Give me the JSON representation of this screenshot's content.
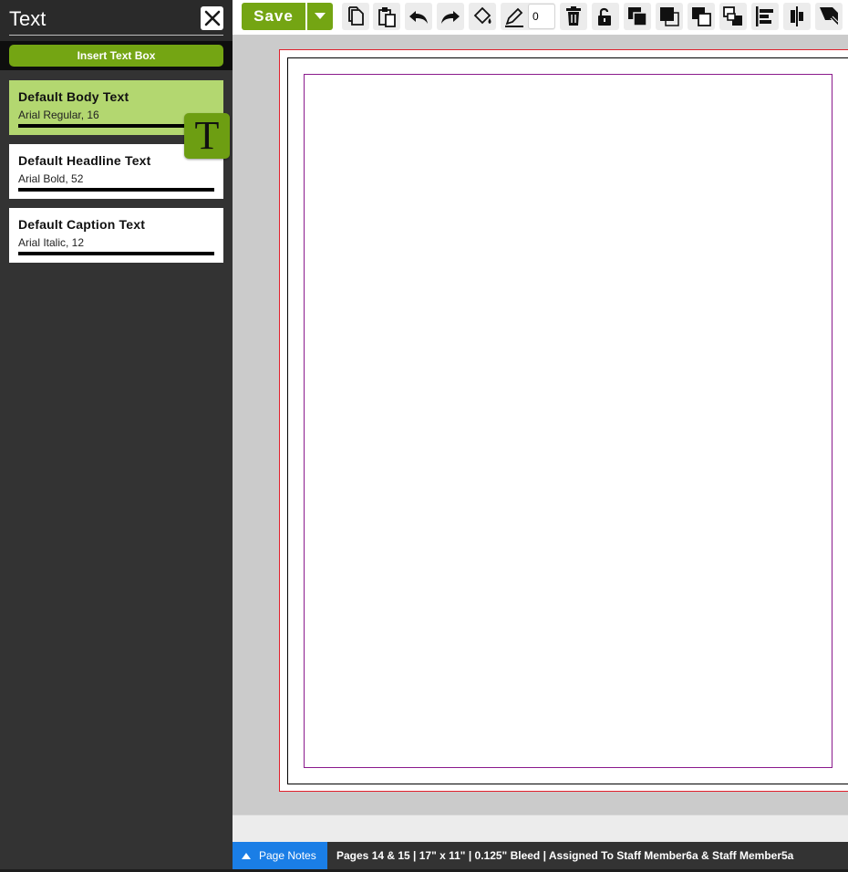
{
  "sidebar": {
    "title": "Text",
    "insert_label": "Insert Text Box",
    "styles": [
      {
        "name": "Default Body Text",
        "meta": "Arial Regular, 16"
      },
      {
        "name": "Default Headline Text",
        "meta": "Arial Bold, 52"
      },
      {
        "name": "Default Caption Text",
        "meta": "Arial Italic, 12"
      }
    ],
    "badge_glyph": "T"
  },
  "toolbar": {
    "save_label": "Save",
    "stroke_width_value": "0",
    "tools": [
      "copy-icon",
      "paste-icon",
      "undo-icon",
      "redo-icon",
      "fill-icon",
      "stroke-icon",
      "delete-icon",
      "unlock-icon",
      "bring-forward-icon",
      "bring-to-front-icon",
      "send-backward-icon",
      "send-to-back-icon",
      "align-left-icon",
      "align-center-icon",
      "shadow-icon"
    ]
  },
  "statusbar": {
    "notes_label": "Page Notes",
    "info": "Pages 14 & 15 | 17\" x 11\" | 0.125\" Bleed | Assigned To Staff Member6a & Staff Member5a"
  },
  "colors": {
    "accent_green": "#74a513",
    "active_card": "#b3d770",
    "notes_blue": "#1a7ee6",
    "bleed_line": "#e0222d",
    "safe_line": "#8a1a8c"
  }
}
